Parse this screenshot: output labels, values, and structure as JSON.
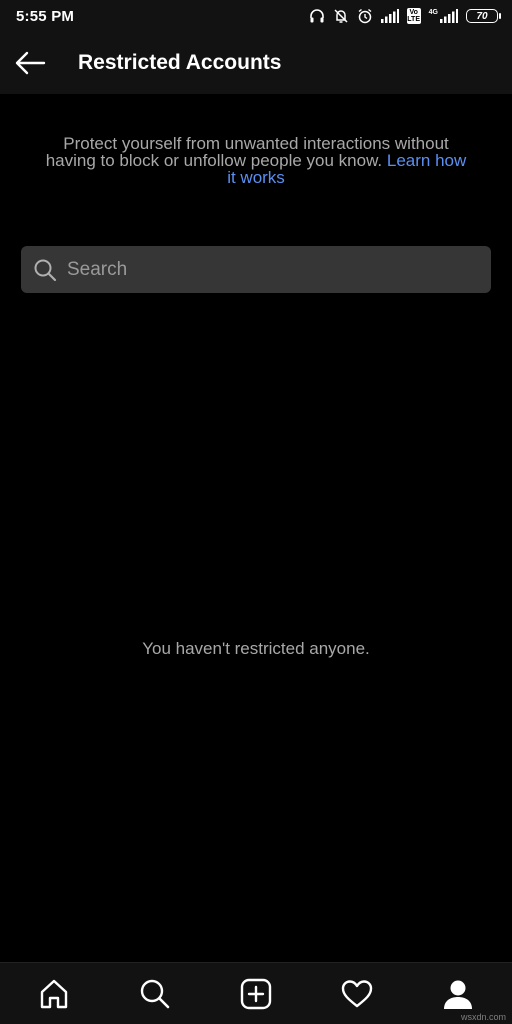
{
  "status_bar": {
    "time": "5:55 PM",
    "volte_top": "Vo",
    "volte_bottom": "LTE",
    "network": "4G",
    "battery": "70",
    "icons": [
      "headphones-icon",
      "alarm-off-icon",
      "alarm-icon",
      "signal-icon",
      "signal-icon"
    ]
  },
  "header": {
    "title": "Restricted Accounts",
    "back_icon": "arrow-left-icon"
  },
  "description": {
    "text": "Protect yourself from unwanted interactions without having to block or unfollow people you know.",
    "link": "Learn how it works"
  },
  "search": {
    "placeholder": "Search",
    "value": ""
  },
  "empty_state": {
    "text": "You haven't restricted anyone."
  },
  "bottom_nav": {
    "items": [
      "home-icon",
      "search-icon",
      "add-post-icon",
      "heart-icon",
      "profile-icon"
    ]
  },
  "watermark": "wsxdn.com",
  "colors": {
    "background": "#000000",
    "bar": "#121212",
    "search_bg": "#363636",
    "muted_text": "#a8a8a8",
    "link": "#5b8ff0"
  }
}
